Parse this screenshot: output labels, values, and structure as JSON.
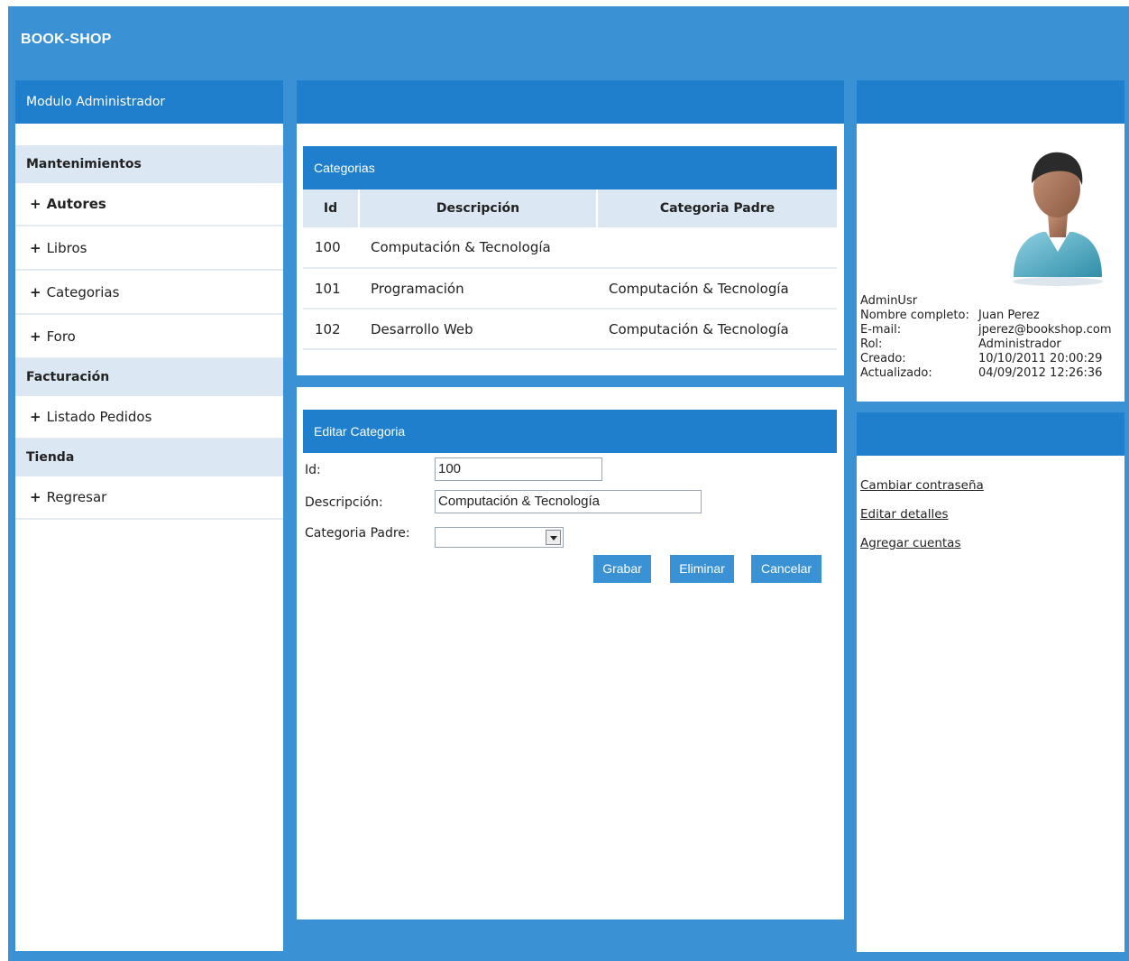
{
  "brand": "BOOK-SHOP",
  "sidebar": {
    "header": "Modulo Administrador",
    "sections": [
      {
        "title": "Mantenimientos",
        "items": [
          "Autores",
          "Libros",
          "Categorias",
          "Foro"
        ]
      },
      {
        "title": "Facturación",
        "items": [
          "Listado Pedidos"
        ]
      },
      {
        "title": "Tienda",
        "items": [
          "Regresar"
        ]
      }
    ]
  },
  "categorias": {
    "title": "Categorias",
    "columns": [
      "Id",
      "Descripción",
      "Categoria Padre"
    ],
    "rows": [
      [
        "100",
        "Computación & Tecnología",
        ""
      ],
      [
        "101",
        "Programación",
        "Computación & Tecnología"
      ],
      [
        "102",
        "Desarrollo Web",
        "Computación & Tecnología"
      ]
    ]
  },
  "editar": {
    "title": "Editar Categoria",
    "id_label": "Id:",
    "id_value": "100",
    "desc_label": "Descripción:",
    "desc_value": "Computación & Tecnología",
    "padre_label": "Categoria Padre:",
    "padre_value": "",
    "buttons": {
      "save": "Grabar",
      "delete": "Eliminar",
      "cancel": "Cancelar"
    }
  },
  "user": {
    "username": "AdminUsr",
    "fields": [
      {
        "label": "Nombre completo:",
        "value": "Juan Perez"
      },
      {
        "label": "E-mail:",
        "value": "jperez@bookshop.com"
      },
      {
        "label": "Rol:",
        "value": "Administrador"
      },
      {
        "label": "Creado:",
        "value": "10/10/2011 20:00:29"
      },
      {
        "label": "Actualizado:",
        "value": "04/09/2012 12:26:36"
      }
    ]
  },
  "account_links": [
    "Cambiar contraseña",
    "Editar detalles",
    "Agregar cuentas"
  ],
  "colors": {
    "frame": "#3a92d4",
    "header": "#1f7fcc",
    "section": "#dbe7f2"
  }
}
